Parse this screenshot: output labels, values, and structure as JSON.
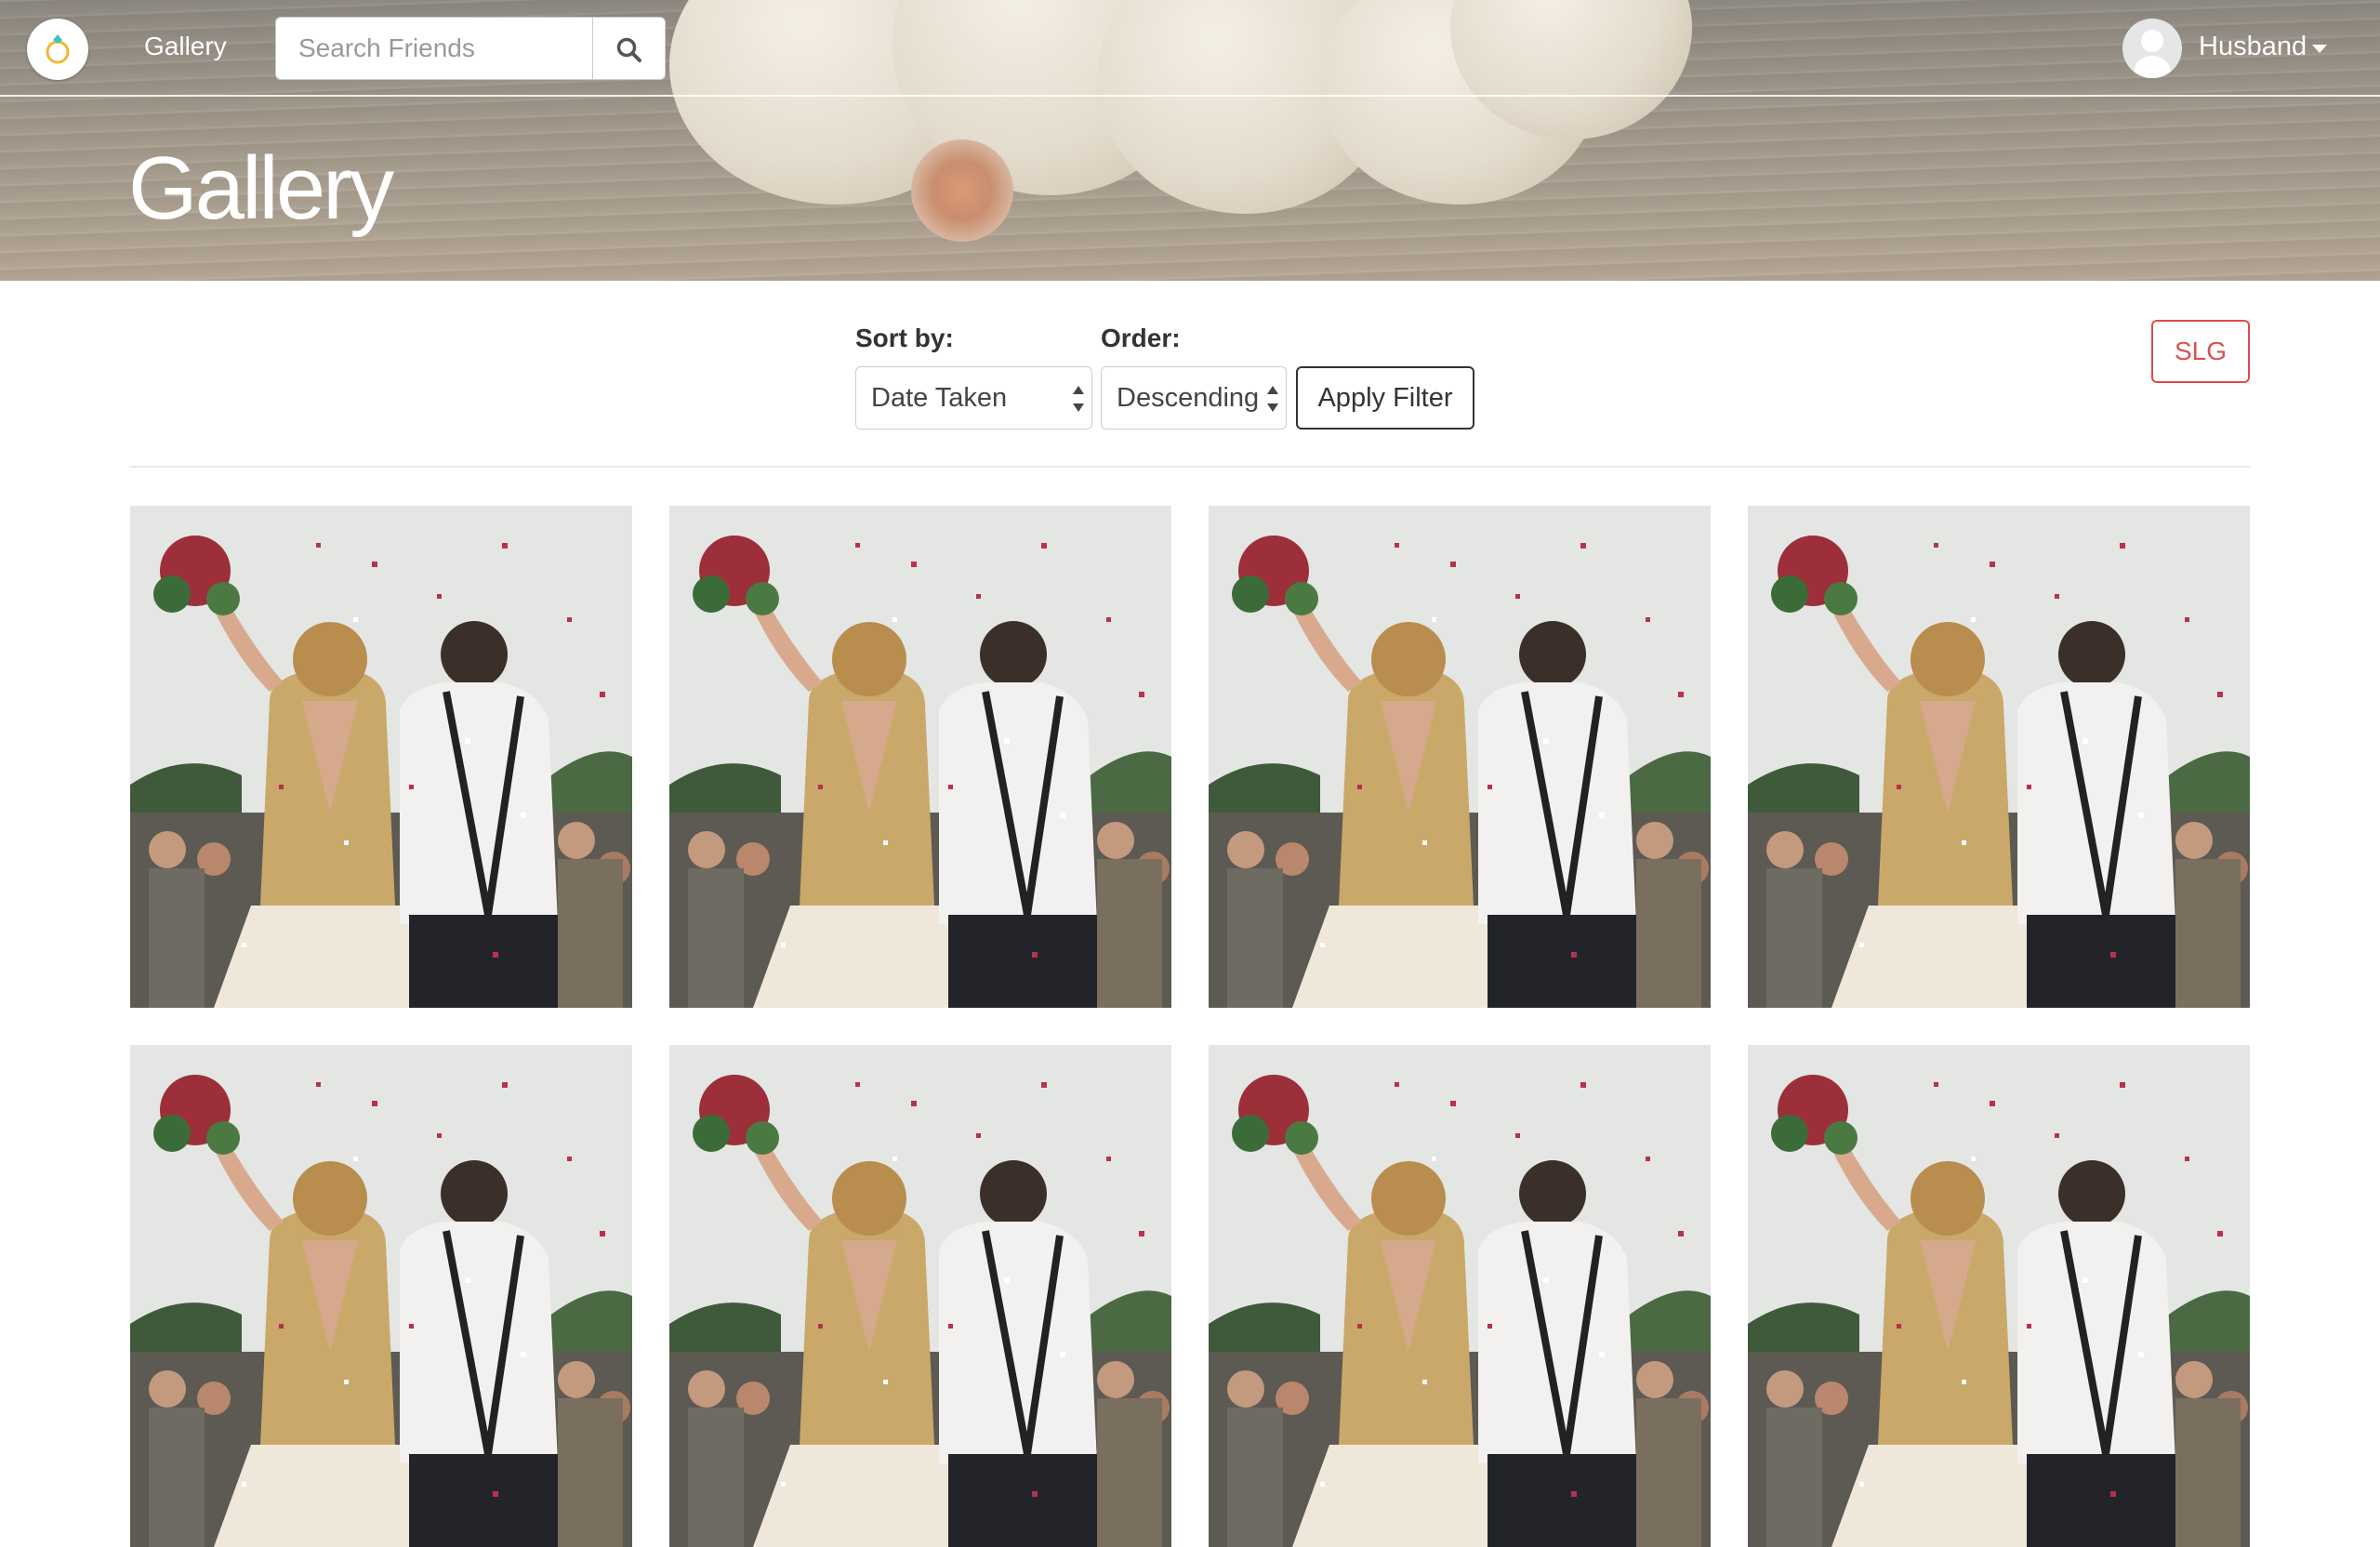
{
  "nav": {
    "link_gallery": "Gallery",
    "search_placeholder": "Search Friends",
    "user_name": "Husband"
  },
  "header": {
    "title": "Gallery"
  },
  "filters": {
    "sort_label": "Sort by:",
    "sort_value": "Date Taken",
    "order_label": "Order:",
    "order_value": "Descending",
    "apply_label": "Apply Filter",
    "slg_label": "SLG"
  },
  "colors": {
    "accent_red": "#d9534f",
    "text_dark": "#333333"
  },
  "gallery": {
    "photos": [
      {
        "subject": "wedding-couple-confetti"
      },
      {
        "subject": "wedding-couple-confetti"
      },
      {
        "subject": "wedding-couple-confetti"
      },
      {
        "subject": "wedding-couple-confetti"
      },
      {
        "subject": "wedding-couple-confetti"
      },
      {
        "subject": "wedding-couple-confetti"
      },
      {
        "subject": "wedding-couple-confetti"
      },
      {
        "subject": "wedding-couple-confetti"
      }
    ]
  }
}
